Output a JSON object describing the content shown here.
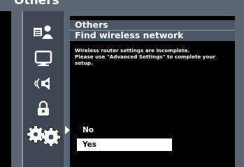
{
  "top_banner": {
    "text": "Others"
  },
  "header": {
    "category": "Others",
    "title": "Find wireless network"
  },
  "message": {
    "line1": "Wireless router settings are incomplete.",
    "line2": "Please use \"Advanced Settings\" to complete your setup."
  },
  "options": [
    {
      "label": "No",
      "selected": false
    },
    {
      "label": "Yes",
      "selected": true
    }
  ],
  "menu_icons": [
    {
      "name": "language-settings-icon",
      "active": false
    },
    {
      "name": "display-monitor-icon",
      "active": false
    },
    {
      "name": "audio-speaker-icon",
      "active": false
    },
    {
      "name": "parental-lock-icon",
      "active": false
    },
    {
      "name": "others-gears-icon",
      "active": true
    }
  ],
  "colors": {
    "frame": "#5a6876",
    "icon_column": "#3d4853",
    "header_bar": "#4a5866",
    "selection": "#ffffff"
  }
}
